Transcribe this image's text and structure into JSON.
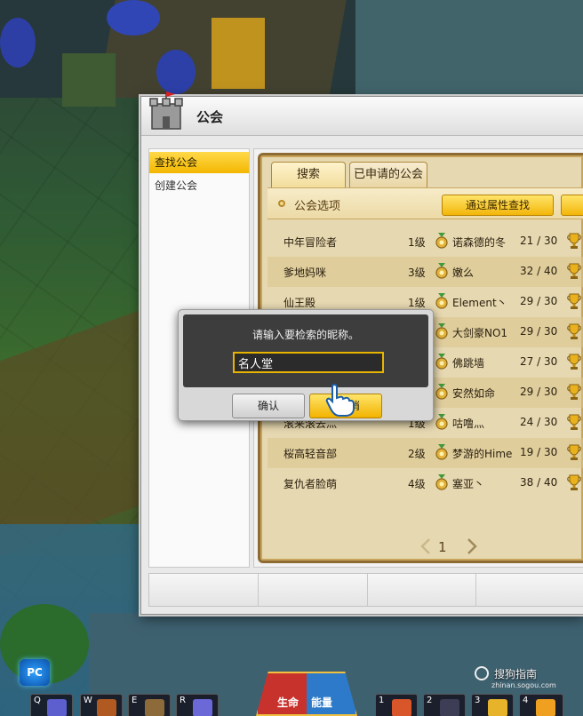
{
  "window": {
    "title": "公会",
    "icon": "castle-icon"
  },
  "sidebar": {
    "items": [
      {
        "label": "查找公会",
        "active": true
      },
      {
        "label": "创建公会",
        "active": false
      }
    ]
  },
  "tabs": [
    {
      "label": "搜索",
      "active": true
    },
    {
      "label": "已申请的公会",
      "active": false
    }
  ],
  "options": {
    "label": "公会选项",
    "attr_search_label": "通过属性查找"
  },
  "guilds": [
    {
      "name": "中年冒险者",
      "level": "1级",
      "leader": "诺森德的冬",
      "members": "21 / 30"
    },
    {
      "name": "爹地妈咪",
      "level": "3级",
      "leader": "嫩么",
      "members": "32 / 40"
    },
    {
      "name": "仙王殿",
      "level": "1级",
      "leader": "Element丶",
      "members": "29 / 30"
    },
    {
      "name": "",
      "level": "",
      "leader": "大剑豪NO1",
      "members": "29 / 30"
    },
    {
      "name": "",
      "level": "",
      "leader": "佛跳墙",
      "members": "27 / 30"
    },
    {
      "name": "",
      "level": "",
      "leader": "安然如命",
      "members": "29 / 30"
    },
    {
      "name": "滚来滚去灬",
      "level": "1级",
      "leader": "咕噜灬",
      "members": "24 / 30"
    },
    {
      "name": "桜高轻音部",
      "level": "2级",
      "leader": "梦游的Hime",
      "members": "19 / 30"
    },
    {
      "name": "复仇者脸萌",
      "level": "4级",
      "leader": "塞亚丶",
      "members": "38 / 40"
    }
  ],
  "pagination": {
    "page": "1"
  },
  "dialog": {
    "prompt": "请输入要检索的昵称。",
    "input_value": "名人堂",
    "confirm_label": "确认",
    "cancel_label": "消"
  },
  "hud": {
    "pc_badge": "PC",
    "orb_left": "生命",
    "orb_right": "能量",
    "hotkeys": [
      "Q",
      "W",
      "E",
      "R",
      "1",
      "2",
      "3",
      "4"
    ]
  },
  "watermark": {
    "brand": "搜狗指南",
    "url": "zhinan.sogou.com"
  },
  "colors": {
    "accent_yellow": "#f3b700",
    "parchment": "#e6d8b0",
    "dialog_bg": "#3d3d3d",
    "frame_brown": "#8e6b32"
  }
}
